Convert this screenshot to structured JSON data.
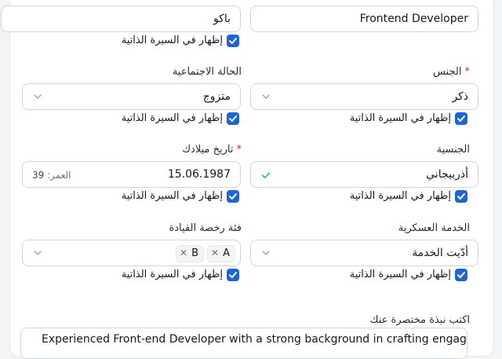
{
  "fields": {
    "position": {
      "value": "Frontend Developer"
    },
    "city": {
      "value": "باكو"
    },
    "gender": {
      "label": "الجنس",
      "required_mark": "*",
      "value": "ذكر"
    },
    "marital_status": {
      "label": "الحالة الاجتماعية",
      "value": "متزوج"
    },
    "nationality": {
      "label": "الجنسية",
      "value": "أذربيجاني"
    },
    "birth_date": {
      "label": "تاريخ ميلادك",
      "required_mark": "*",
      "value": "15.06.1987",
      "age_label": "العمر:",
      "age_value": "39"
    },
    "military_service": {
      "label": "الخدمة العسكرية",
      "value": "أدّيت الخدمة"
    },
    "driving_license": {
      "label": "فئة رخصة القيادة",
      "tags": [
        "A",
        "B"
      ]
    },
    "about": {
      "label": "اكتب نبذة مختصرة عنك",
      "value": "Experienced Front-end Developer with a strong background in crafting engaging"
    }
  },
  "show_in_cv_label": "إظهار في السيرة الذاتية",
  "icons": {
    "chevron": "chevron-down-icon",
    "check": "checkmark-icon",
    "remove": "close-icon"
  },
  "colors": {
    "accent": "#1d64d8",
    "required": "#dc2626",
    "valid": "#22c55e"
  }
}
